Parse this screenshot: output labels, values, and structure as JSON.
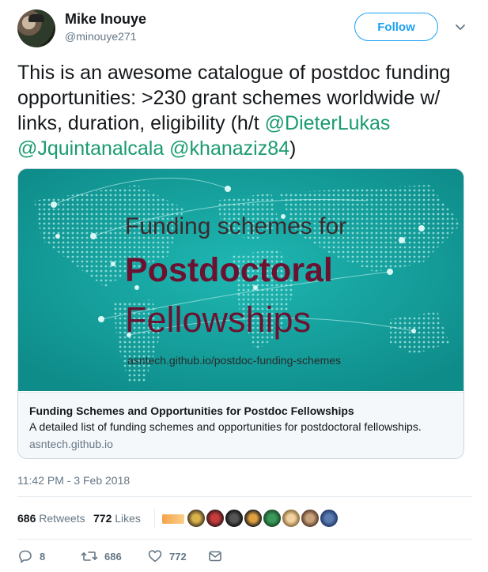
{
  "user": {
    "name": "Mike Inouye",
    "handle": "@minouye271"
  },
  "follow_label": "Follow",
  "tweet": {
    "text_plain": "This is an awesome catalogue of postdoc funding opportunities: >230 grant schemes worldwide w/ links, duration, eligibility (h/t ",
    "mentions": [
      "@DieterLukas",
      "@Jquintanalcala",
      "@khanaziz84"
    ],
    "text_end": ")"
  },
  "card": {
    "image": {
      "line1": "Funding schemes for",
      "line2": "Postdoctoral",
      "line3": "Fellowships",
      "url": "asntech.github.io/postdoc-funding-schemes"
    },
    "title": "Funding Schemes and Opportunities for Postdoc Fellowships",
    "description": "A detailed list of funding schemes and opportunities for postdoctoral fellowships.",
    "domain": "asntech.github.io"
  },
  "timestamp": "11:42 PM - 3 Feb 2018",
  "stats": {
    "retweets_count": "686",
    "retweets_label": "Retweets",
    "likes_count": "772",
    "likes_label": "Likes"
  },
  "actions": {
    "reply_count": "8",
    "retweet_count": "686",
    "like_count": "772"
  },
  "colors": {
    "accent": "#1da1f2",
    "mention": "#1a9b71",
    "card_bg": "#16a09e",
    "headline": "#6b1231"
  },
  "icons": [
    "chevron-down-icon",
    "reply-icon",
    "retweet-icon",
    "heart-icon",
    "envelope-icon",
    "map-pin-icon"
  ]
}
